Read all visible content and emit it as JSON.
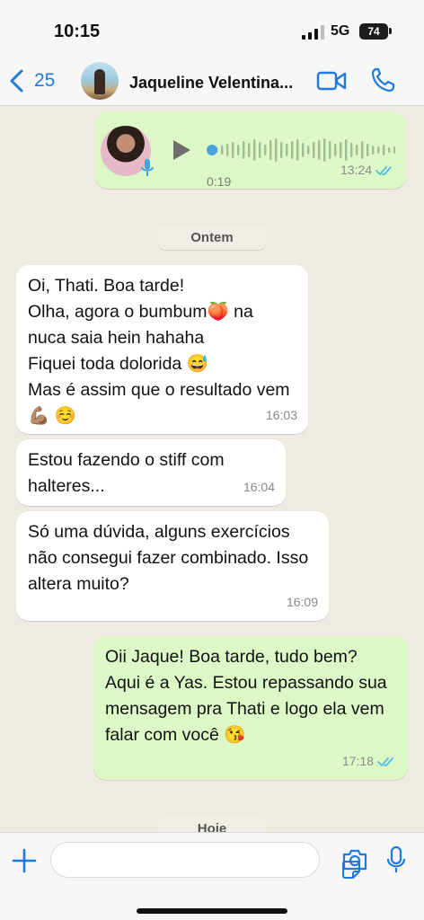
{
  "status_bar": {
    "time": "10:15",
    "network": "5G",
    "battery": "74"
  },
  "header": {
    "back_count": "25",
    "contact_name": "Jaqueline Velentina..."
  },
  "voice_note": {
    "duration": "0:19",
    "time": "13:24",
    "progress": 0.0
  },
  "date_separators": {
    "yesterday": "Ontem",
    "today": "Hoje"
  },
  "messages": [
    {
      "text": "Oi, Thati. Boa tarde!\nOlha, agora o bumbum🍑 na nuca saia hein hahaha\nFiquei toda dolorida 😅\nMas é assim que o resultado vem💪🏽 ☺️",
      "time": "16:03"
    },
    {
      "text": "Estou fazendo o stiff com halteres...",
      "time": "16:04"
    },
    {
      "text": "Só uma dúvida, alguns exercícios não consegui fazer combinado. Isso altera muito?",
      "time": "16:09"
    },
    {
      "text": "Oii Jaque! Boa tarde, tudo bem? Aqui é a Yas. Estou repassando sua mensagem pra Thati e logo ela vem falar com você 😘",
      "time": "17:18"
    }
  ],
  "colors": {
    "accent": "#1f7ae0",
    "outgoing": "#dcf8c6",
    "incoming": "#ffffff",
    "read_ticks": "#53bdeb"
  }
}
